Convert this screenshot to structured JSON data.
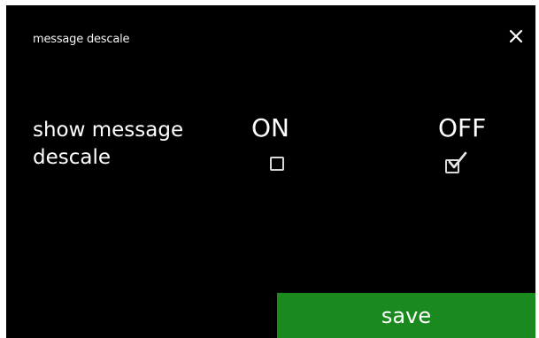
{
  "header": {
    "title": "message descale",
    "close_icon": "close-icon"
  },
  "setting": {
    "label_line1": "show message",
    "label_line2": "descale",
    "options": [
      {
        "label": "ON",
        "checked": false
      },
      {
        "label": "OFF",
        "checked": true
      }
    ]
  },
  "footer": {
    "save_label": "save"
  },
  "colors": {
    "background": "#000000",
    "text": "#ffffff",
    "save_button": "#1a8a1e"
  }
}
